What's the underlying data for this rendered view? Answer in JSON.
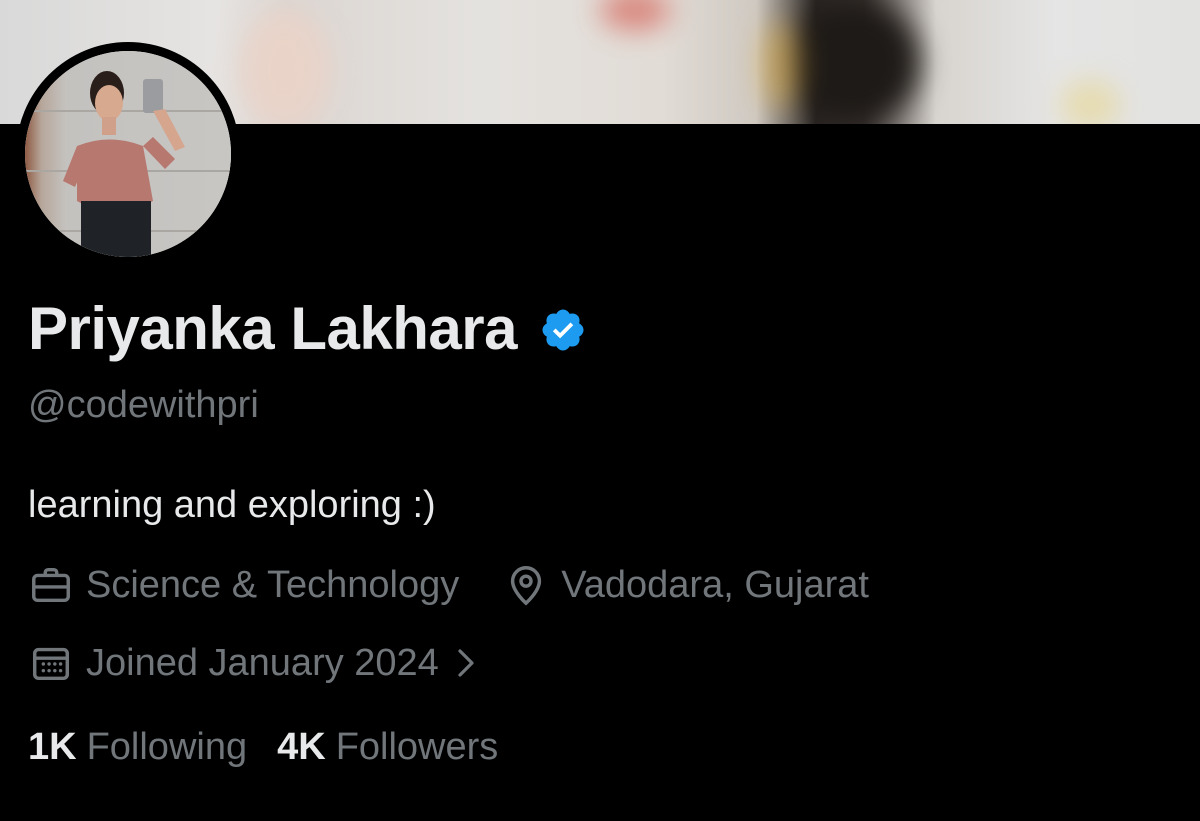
{
  "profile": {
    "display_name": "Priyanka Lakhara",
    "handle": "@codewithpri",
    "bio": "learning and exploring :)",
    "verified": true,
    "category": "Science & Technology",
    "location": "Vadodara, Gujarat",
    "joined": "Joined January 2024"
  },
  "stats": {
    "following_count": "1K",
    "following_label": "Following",
    "followers_count": "4K",
    "followers_label": "Followers"
  },
  "icons": {
    "verified": "verified-badge-icon",
    "category": "briefcase-icon",
    "location": "location-pin-icon",
    "joined": "calendar-icon",
    "joined_more": "chevron-right-icon"
  },
  "colors": {
    "background": "#000000",
    "primary_text": "#e7e9ea",
    "secondary_text": "#71767b",
    "verified_blue": "#1d9bf0"
  }
}
